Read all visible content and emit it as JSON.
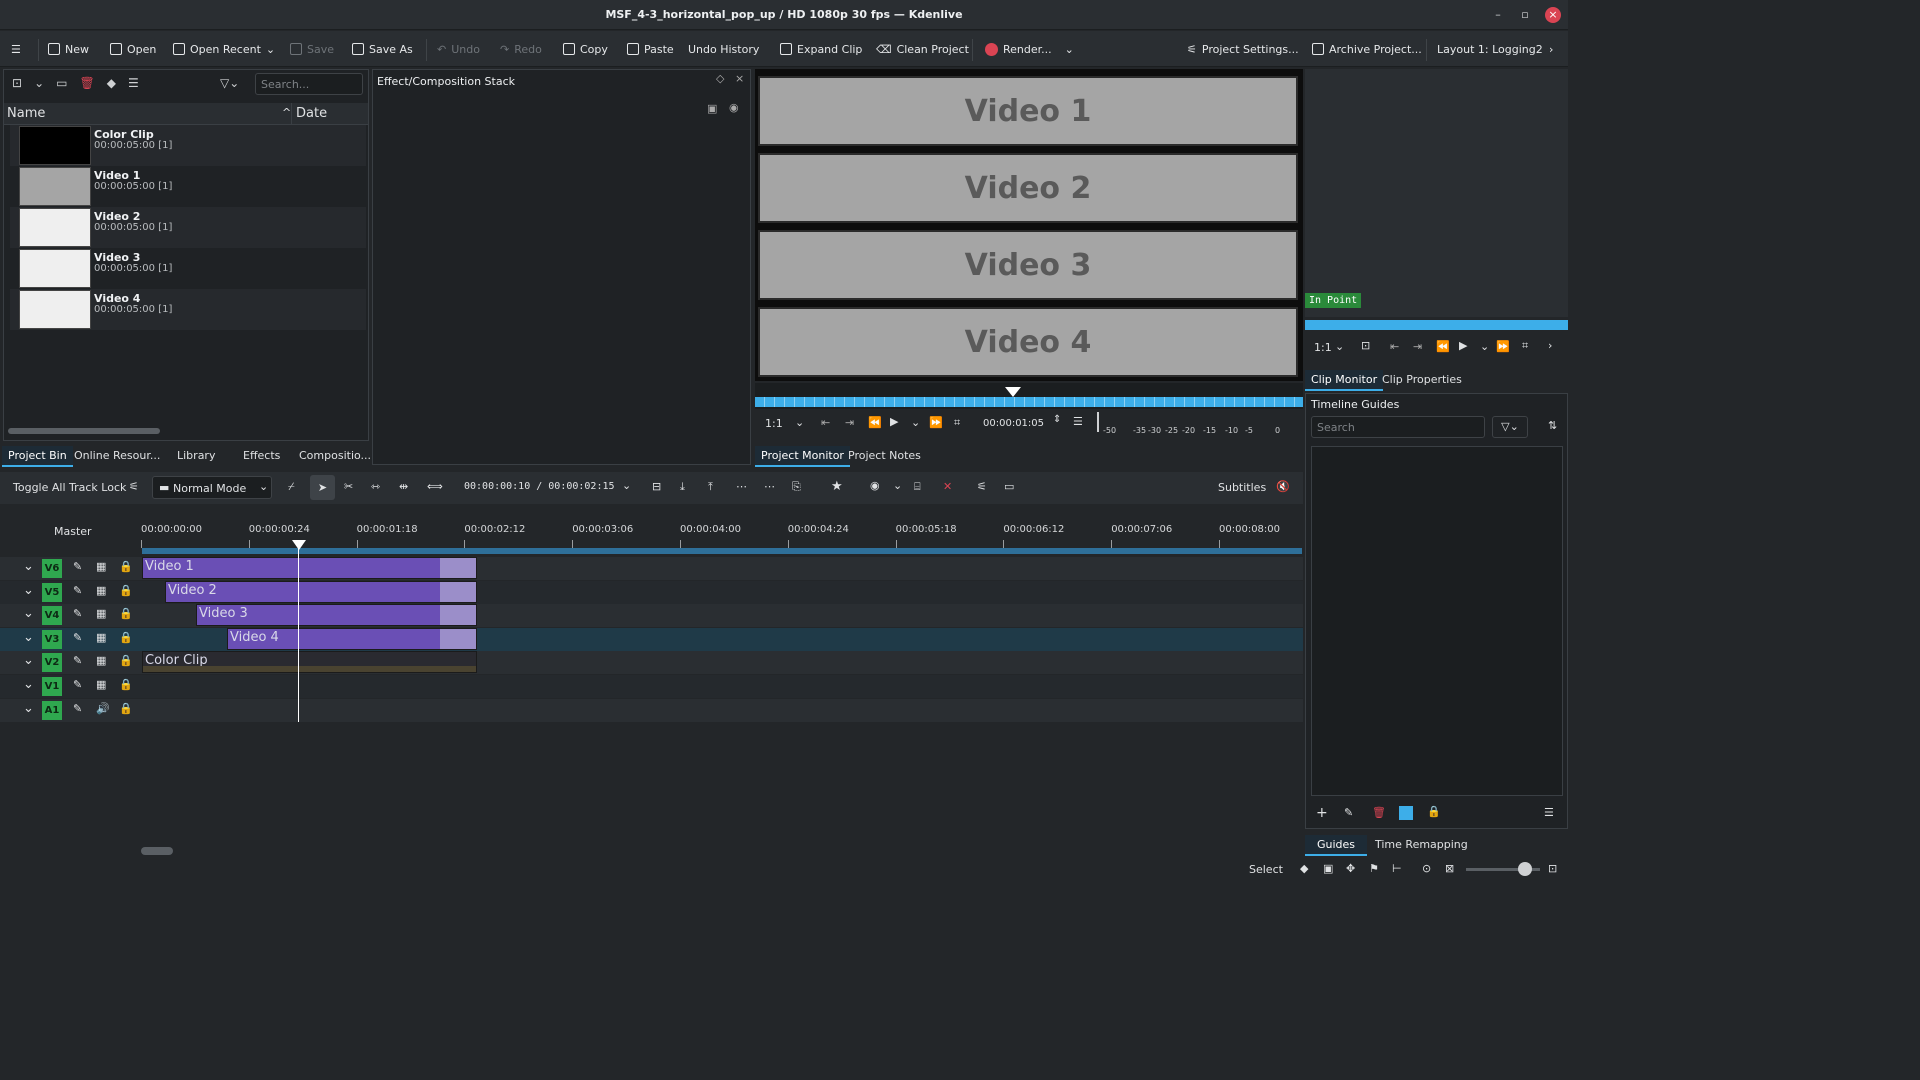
{
  "window": {
    "title": "MSF_4-3_horizontal_pop_up / HD 1080p 30 fps — Kdenlive"
  },
  "toolbar": {
    "new": "New",
    "open": "Open",
    "open_recent": "Open Recent",
    "save": "Save",
    "save_as": "Save As",
    "undo": "Undo",
    "redo": "Redo",
    "copy": "Copy",
    "paste": "Paste",
    "undo_history": "Undo History",
    "expand_clip": "Expand Clip",
    "clean_project": "Clean Project",
    "render": "Render...",
    "project_settings": "Project Settings...",
    "archive_project": "Archive Project...",
    "layout": "Layout 1: Logging2"
  },
  "bin": {
    "search_placeholder": "Search...",
    "col_name": "Name",
    "col_date": "Date",
    "items": [
      {
        "title": "Color Clip",
        "sub": "00:00:05:00 [1]"
      },
      {
        "title": "Video 1",
        "sub": "00:00:05:00 [1]"
      },
      {
        "title": "Video 2",
        "sub": "00:00:05:00 [1]"
      },
      {
        "title": "Video 3",
        "sub": "00:00:05:00 [1]"
      },
      {
        "title": "Video 4",
        "sub": "00:00:05:00 [1]"
      }
    ]
  },
  "left_tabs": [
    "Project Bin",
    "Online Resour...",
    "Library",
    "Effects",
    "Compositio..."
  ],
  "effect_stack": {
    "title": "Effect/Composition Stack"
  },
  "project_monitor": {
    "videos": [
      "Video 1",
      "Video 2",
      "Video 3",
      "Video 4"
    ],
    "zoom": "1:1",
    "timecode": "00:00:01:05",
    "meter": [
      "-50",
      "-35",
      "-30",
      "-25",
      "-20",
      "-15",
      "-10",
      "-5",
      "0"
    ]
  },
  "monitor_tabs": [
    "Project Monitor",
    "Project Notes"
  ],
  "clip_monitor": {
    "in_point": "In Point",
    "zoom": "1:1",
    "tabs": [
      "Clip Monitor",
      "Clip Properties"
    ]
  },
  "guides": {
    "title": "Timeline Guides",
    "search_placeholder": "Search",
    "tabs": [
      "Guides",
      "Time Remapping"
    ]
  },
  "timeline_toolbar": {
    "toggle_lock": "Toggle All Track Lock",
    "mode": "Normal Mode",
    "timecode": "00:00:00:10 / 00:00:02:15",
    "subtitles": "Subtitles"
  },
  "timeline": {
    "master": "Master",
    "ruler": [
      "00:00:00:00",
      "00:00:00:24",
      "00:00:01:18",
      "00:00:02:12",
      "00:00:03:06",
      "00:00:04:00",
      "00:00:04:24",
      "00:00:05:18",
      "00:00:06:12",
      "00:00:07:06",
      "00:00:08:00"
    ],
    "tracks": [
      "V6",
      "V5",
      "V4",
      "V3",
      "V2",
      "V1",
      "A1"
    ],
    "clips": [
      {
        "label": "Video 1",
        "track": "V6"
      },
      {
        "label": "Video 2",
        "track": "V5"
      },
      {
        "label": "Video 3",
        "track": "V4"
      },
      {
        "label": "Video 4",
        "track": "V3"
      },
      {
        "label": "Color Clip",
        "track": "V2"
      }
    ]
  },
  "status": {
    "select": "Select"
  },
  "colors": {
    "accent": "#3daee9",
    "track_tag": "#2fa84f",
    "clip": "#6a4fb5",
    "record": "#da4453"
  }
}
